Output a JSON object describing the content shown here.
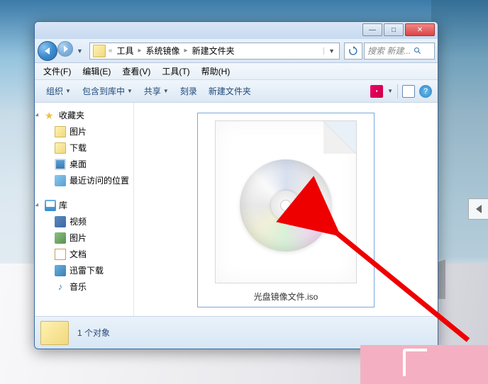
{
  "titlebar": {
    "min": "—",
    "max": "□",
    "close": "✕"
  },
  "nav": {
    "breadcrumb": [
      "工具",
      "系统镜像",
      "新建文件夹"
    ],
    "search_placeholder": "搜索 新建..."
  },
  "menubar": {
    "file": "文件(F)",
    "edit": "编辑(E)",
    "view": "查看(V)",
    "tools": "工具(T)",
    "help": "帮助(H)"
  },
  "toolbar": {
    "organize": "组织",
    "include": "包含到库中",
    "share": "共享",
    "burn": "刻录",
    "new_folder": "新建文件夹"
  },
  "sidebar": {
    "favorites": {
      "label": "收藏夹",
      "items": [
        "图片",
        "下载",
        "桌面",
        "最近访问的位置"
      ]
    },
    "libraries": {
      "label": "库",
      "items": [
        "视频",
        "图片",
        "文档",
        "迅雷下载",
        "音乐"
      ]
    }
  },
  "file": {
    "name": "光盘镜像文件.iso"
  },
  "statusbar": {
    "count": "1 个对象"
  }
}
